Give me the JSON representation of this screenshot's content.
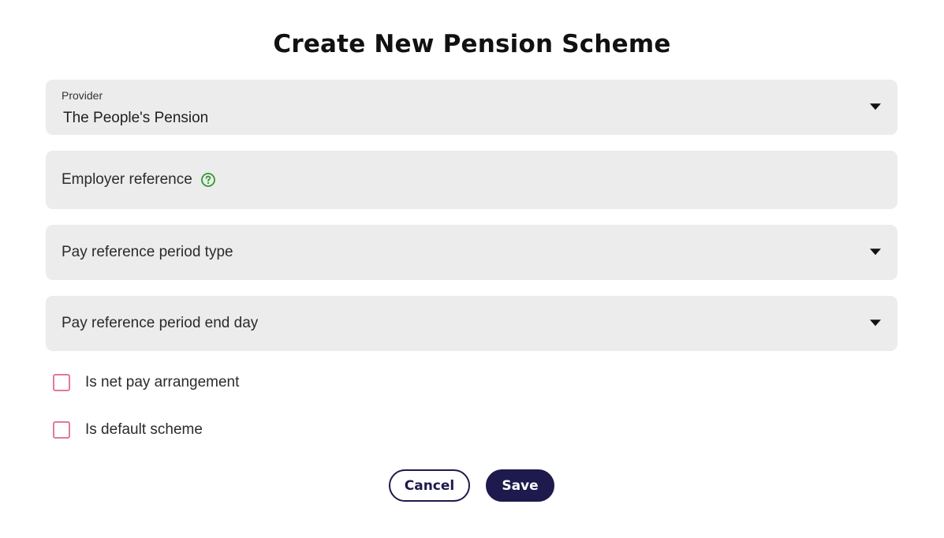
{
  "dialog": {
    "title": "Create New Pension Scheme"
  },
  "form": {
    "provider": {
      "label": "Provider",
      "value": "The People's Pension",
      "icon": "chevron-down-icon"
    },
    "employer_reference": {
      "placeholder": "Employer reference",
      "help_icon": "help-circle-icon",
      "help_color": "#2e9a2e"
    },
    "pay_reference_period_type": {
      "placeholder": "Pay reference period type",
      "icon": "chevron-down-icon"
    },
    "pay_reference_period_end_day": {
      "placeholder": "Pay reference period end day",
      "icon": "chevron-down-icon"
    },
    "is_net_pay_arrangement": {
      "label": "Is net pay arrangement",
      "checked": false
    },
    "is_default_scheme": {
      "label": "Is default scheme",
      "checked": false
    }
  },
  "actions": {
    "cancel_label": "Cancel",
    "save_label": "Save"
  },
  "colors": {
    "field_background": "#ececec",
    "primary": "#1e1a4d",
    "checkbox_border": "#e07a98"
  }
}
